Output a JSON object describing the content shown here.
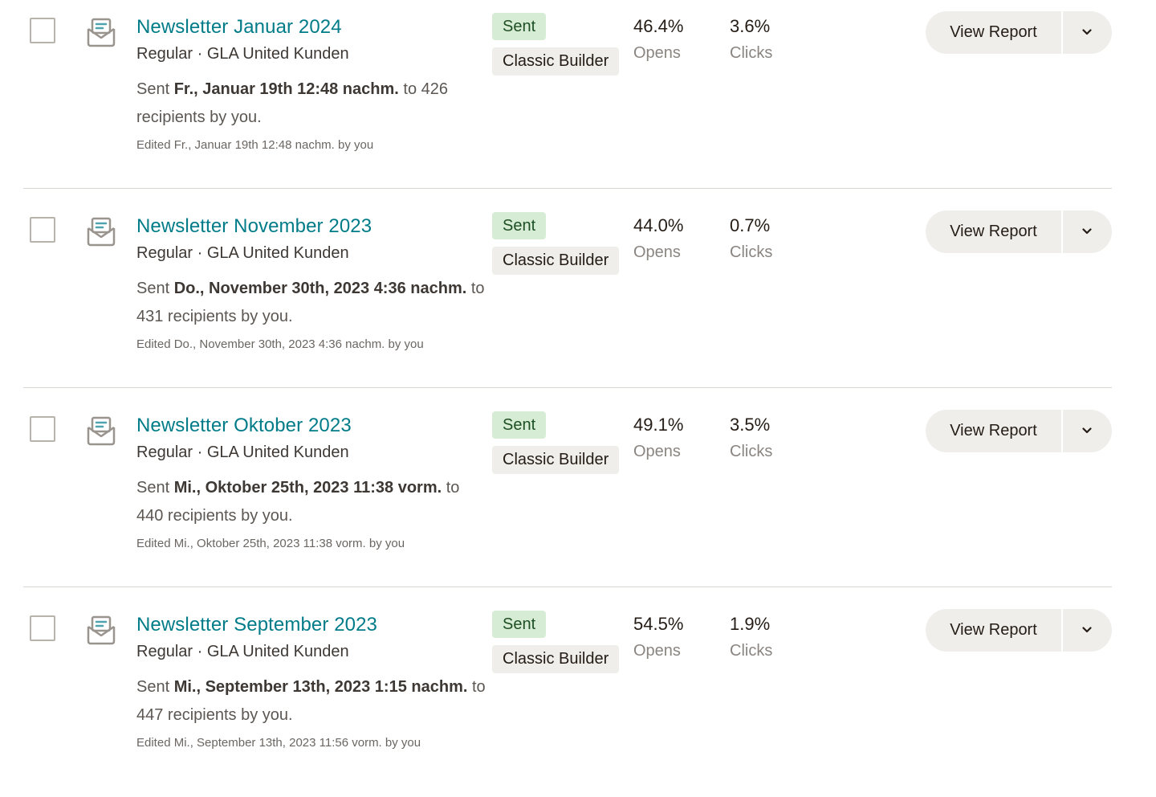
{
  "campaigns": [
    {
      "title": "Newsletter Januar 2024",
      "meta": "Regular · GLA United Kunden",
      "sent_prefix": "Sent ",
      "sent_date": "Fr., Januar 19th 12:48 nachm.",
      "sent_suffix": " to 426 recipients by you.",
      "edited": "Edited Fr., Januar 19th 12:48 nachm. by you",
      "status": "Sent",
      "builder": "Classic Builder",
      "opens_value": "46.4%",
      "opens_label": "Opens",
      "clicks_value": "3.6%",
      "clicks_label": "Clicks",
      "report_label": "View Report"
    },
    {
      "title": "Newsletter November 2023",
      "meta": "Regular · GLA United Kunden",
      "sent_prefix": "Sent ",
      "sent_date": "Do., November 30th, 2023 4:36 nachm.",
      "sent_suffix": " to 431 recipients by you.",
      "edited": "Edited Do., November 30th, 2023 4:36 nachm. by you",
      "status": "Sent",
      "builder": "Classic Builder",
      "opens_value": "44.0%",
      "opens_label": "Opens",
      "clicks_value": "0.7%",
      "clicks_label": "Clicks",
      "report_label": "View Report"
    },
    {
      "title": "Newsletter Oktober 2023",
      "meta": "Regular · GLA United Kunden",
      "sent_prefix": "Sent ",
      "sent_date": "Mi., Oktober 25th, 2023 11:38 vorm.",
      "sent_suffix": " to 440 recipients by you.",
      "edited": "Edited Mi., Oktober 25th, 2023 11:38 vorm. by you",
      "status": "Sent",
      "builder": "Classic Builder",
      "opens_value": "49.1%",
      "opens_label": "Opens",
      "clicks_value": "3.5%",
      "clicks_label": "Clicks",
      "report_label": "View Report"
    },
    {
      "title": "Newsletter September 2023",
      "meta": "Regular · GLA United Kunden",
      "sent_prefix": "Sent ",
      "sent_date": "Mi., September 13th, 2023 1:15 nachm.",
      "sent_suffix": " to 447 recipients by you.",
      "edited": "Edited Mi., September 13th, 2023 11:56 vorm. by you",
      "status": "Sent",
      "builder": "Classic Builder",
      "opens_value": "54.5%",
      "opens_label": "Opens",
      "clicks_value": "1.9%",
      "clicks_label": "Clicks",
      "report_label": "View Report"
    }
  ],
  "icons": {
    "campaign_type": "email-envelope-icon",
    "dropdown": "chevron-down-icon"
  },
  "colors": {
    "link": "#007c89",
    "status_bg": "#d7ecd4",
    "builder_bg": "#efeeea",
    "button_bg": "#efeeea"
  }
}
